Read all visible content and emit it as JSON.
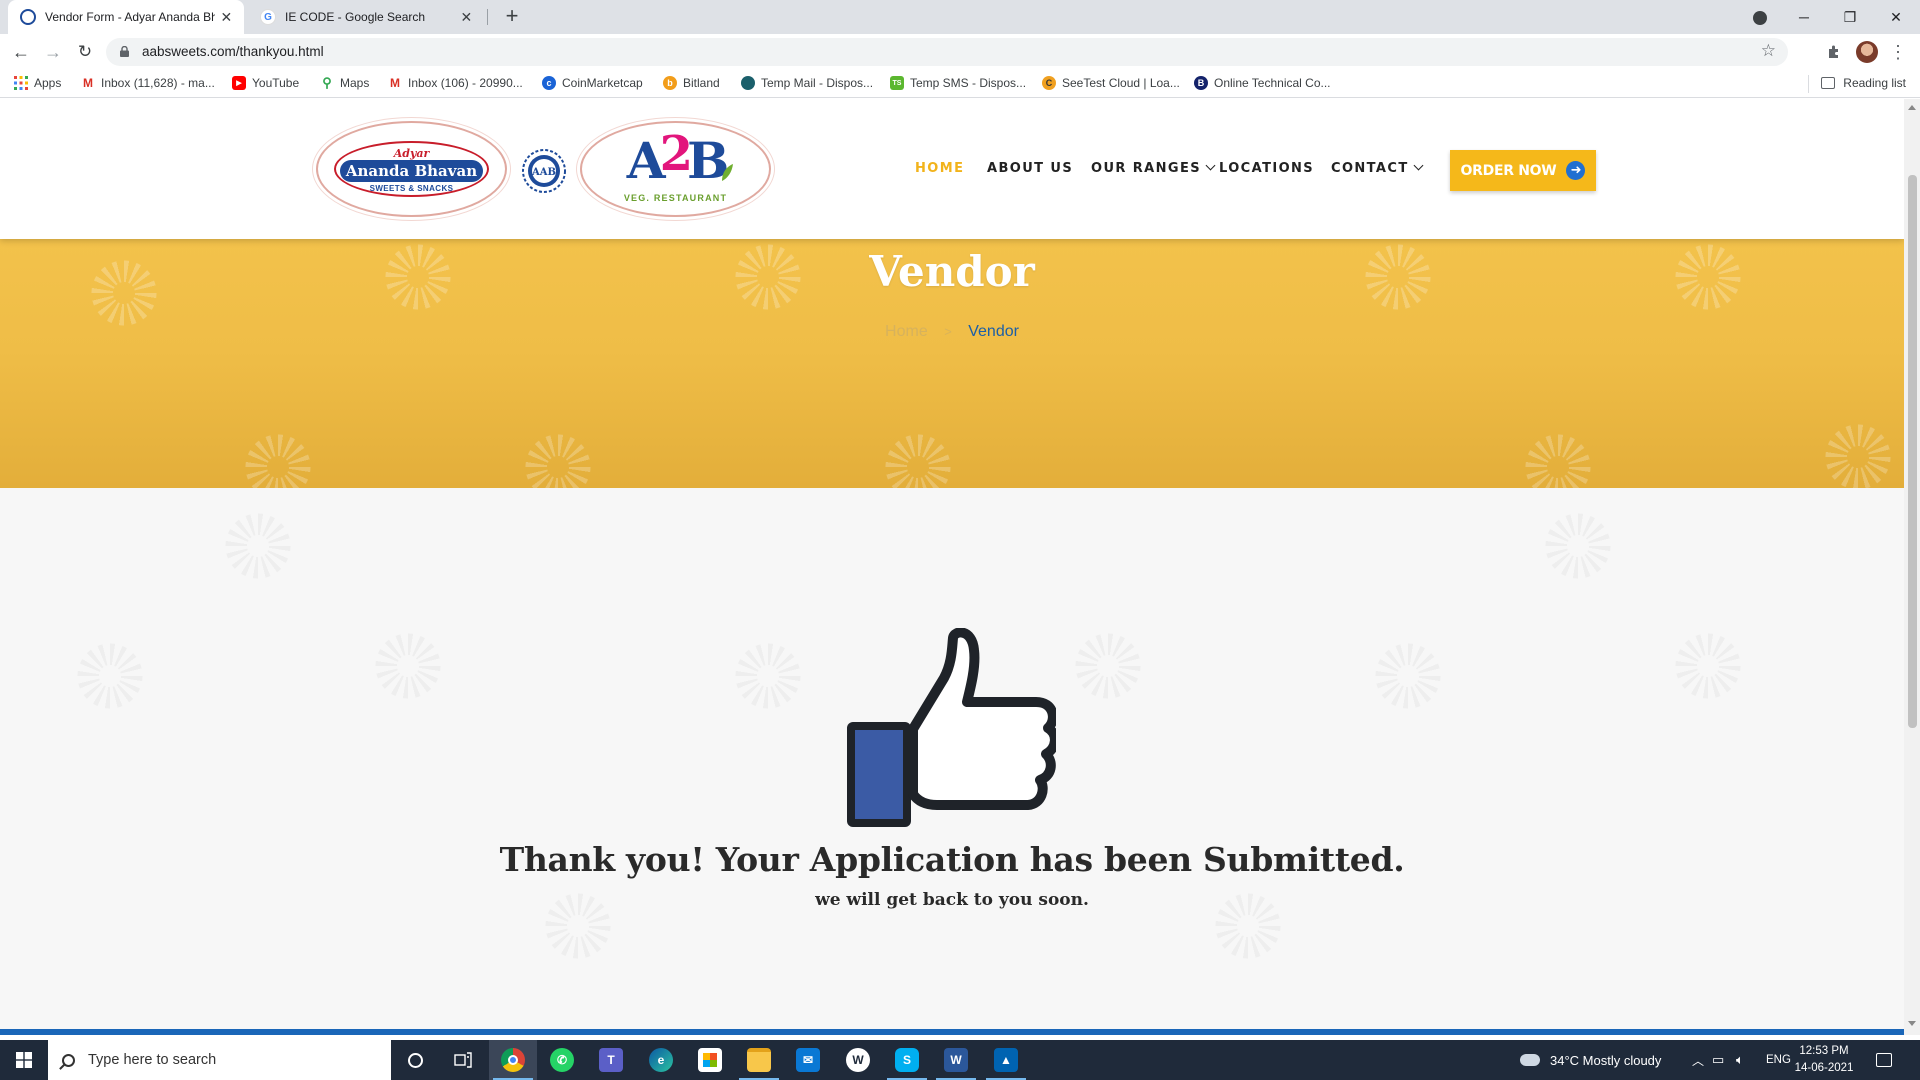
{
  "browser": {
    "tabs": [
      {
        "title": "Vendor Form - Adyar Ananda Bh",
        "active": true
      },
      {
        "title": "IE CODE - Google Search",
        "active": false
      }
    ],
    "url": "aabsweets.com/thankyou.html",
    "bookmarks": [
      {
        "label": "Apps",
        "icon": "apps-grid-icon"
      },
      {
        "label": "Inbox (11,628) - ma...",
        "icon": "gmail-icon"
      },
      {
        "label": "YouTube",
        "icon": "youtube-icon"
      },
      {
        "label": "Maps",
        "icon": "maps-icon"
      },
      {
        "label": "Inbox (106) - 20990...",
        "icon": "gmail-icon"
      },
      {
        "label": "CoinMarketcap",
        "icon": "coinmarketcap-icon"
      },
      {
        "label": "Bitland",
        "icon": "bitland-icon"
      },
      {
        "label": "Temp Mail - Dispos...",
        "icon": "tempmail-icon"
      },
      {
        "label": "Temp SMS - Dispos...",
        "icon": "tempsms-icon"
      },
      {
        "label": "SeeTest Cloud | Loa...",
        "icon": "seetest-icon"
      },
      {
        "label": "Online Technical Co...",
        "icon": "online-technical-icon"
      }
    ],
    "reading_list": "Reading list"
  },
  "site": {
    "logo_aab": {
      "top": "Adyar",
      "name": "Ananda Bhavan",
      "tagline": "SWEETS & SNACKS"
    },
    "emblem": "AAB",
    "logo_a2b": {
      "a": "A",
      "two": "2",
      "b": "B",
      "tagline": "VEG. RESTAURANT"
    },
    "nav": [
      {
        "label": "HOME",
        "active": true,
        "dropdown": false
      },
      {
        "label": "ABOUT US",
        "active": false,
        "dropdown": false
      },
      {
        "label": "OUR RANGES",
        "active": false,
        "dropdown": true
      },
      {
        "label": "LOCATIONS",
        "active": false,
        "dropdown": false
      },
      {
        "label": "CONTACT",
        "active": false,
        "dropdown": true
      }
    ],
    "order_button": "ORDER NOW",
    "hero": {
      "title": "Vendor",
      "breadcrumb_home": "Home",
      "breadcrumb_sep": ">",
      "breadcrumb_current": "Vendor"
    },
    "thanks": {
      "title": "Thank you! Your Application has been Submitted.",
      "subtitle": "we will get back to you soon."
    },
    "colors": {
      "accent": "#f5b81a",
      "hero": "#f0bf48",
      "link": "#1c5fa6",
      "thumb": "#3b5ba5"
    }
  },
  "taskbar": {
    "search_placeholder": "Type here to search",
    "weather": "34°C  Mostly cloudy",
    "language": "ENG",
    "time": "12:53 PM",
    "date": "14-06-2021"
  }
}
